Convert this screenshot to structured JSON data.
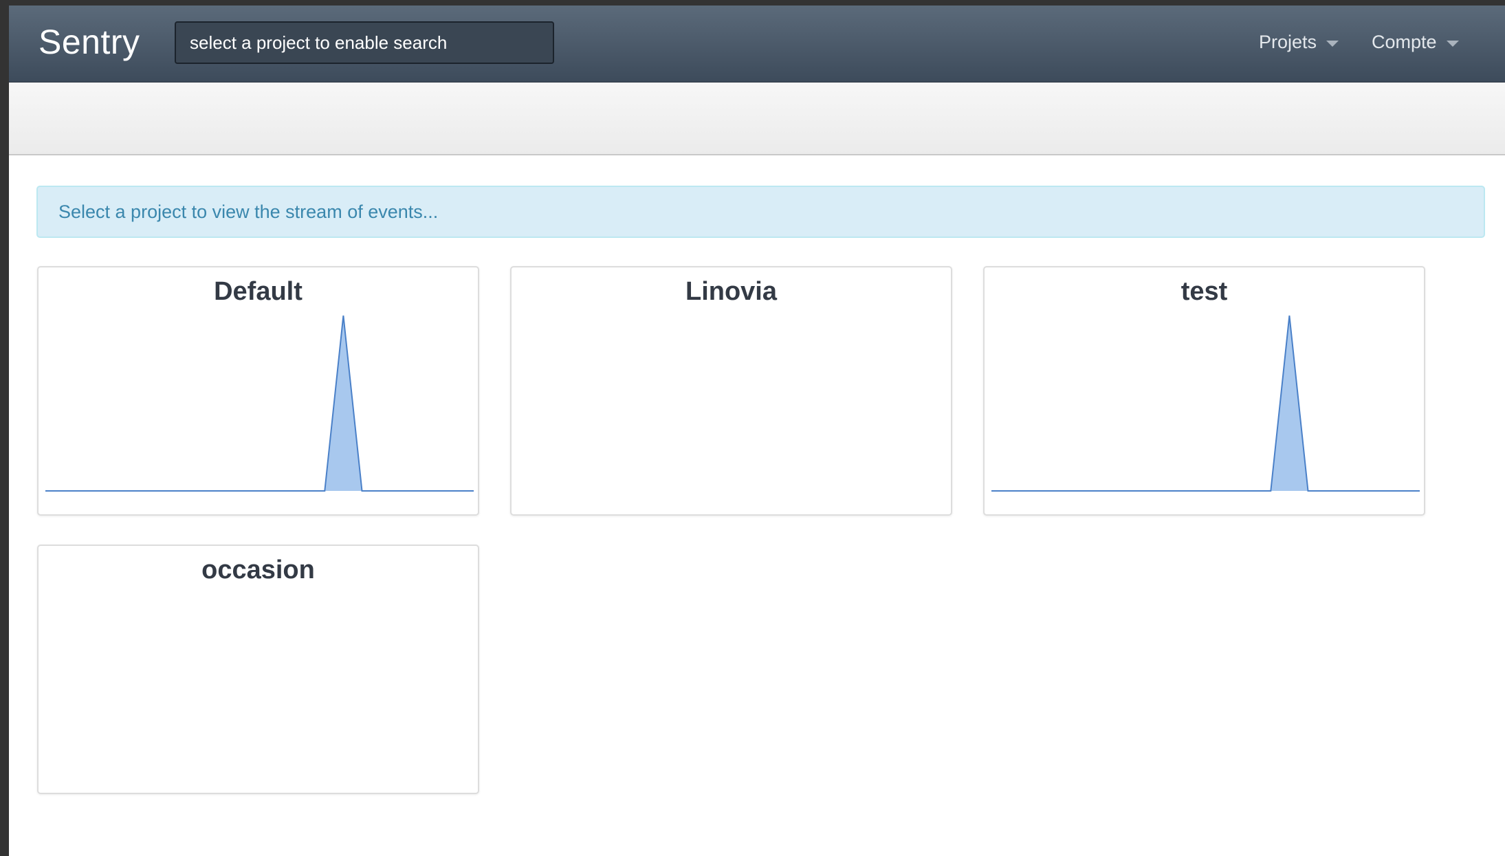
{
  "navbar": {
    "brand": "Sentry",
    "search_placeholder": "select a project to enable search",
    "menus": [
      {
        "label": "Projets"
      },
      {
        "label": "Compte"
      }
    ]
  },
  "alert": {
    "text": "Select a project to view the stream of events..."
  },
  "projects": [
    {
      "name": "Default",
      "sparkline": [
        0,
        0,
        0,
        0,
        0,
        0,
        0,
        0,
        0,
        0,
        0,
        0,
        0,
        0,
        0,
        0,
        1,
        0,
        0,
        0,
        0,
        0,
        0,
        0
      ]
    },
    {
      "name": "Linovia",
      "sparkline": []
    },
    {
      "name": "test",
      "sparkline": [
        0,
        0,
        0,
        0,
        0,
        0,
        0,
        0,
        0,
        0,
        0,
        0,
        0,
        0,
        0,
        0,
        1,
        0,
        0,
        0,
        0,
        0,
        0,
        0
      ]
    },
    {
      "name": "occasion",
      "sparkline": []
    }
  ],
  "colors": {
    "navbar": "#4a5868",
    "alert_bg": "#d9edf7",
    "alert_text": "#3a87ad",
    "spark_fill": "#a8c8ee",
    "spark_stroke": "#4a80c8"
  }
}
